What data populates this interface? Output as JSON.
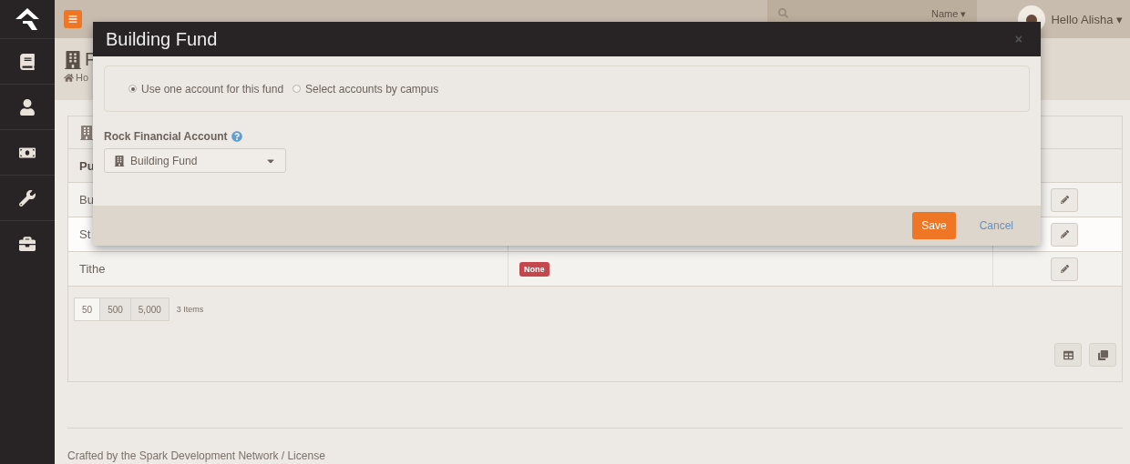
{
  "topbar": {
    "search_filter": "Name",
    "filter_caret": "▾",
    "user_greeting": "Hello Alisha",
    "user_caret": "▾"
  },
  "page": {
    "title": "F",
    "breadcrumb": "Ho"
  },
  "grid": {
    "header": "Pu",
    "rows": [
      {
        "name": "Bu",
        "selected": false
      },
      {
        "name": "St",
        "selected": true
      },
      {
        "name": "Tithe",
        "badge": "None",
        "selected": false
      }
    ],
    "page_sizes": [
      {
        "label": "50",
        "selected": true
      },
      {
        "label": "500",
        "selected": false
      },
      {
        "label": "5,000",
        "selected": false
      }
    ],
    "item_count": "3 Items"
  },
  "footer": "Crafted by the Spark Development Network / License",
  "modal": {
    "title": "Building Fund",
    "close": "×",
    "options": [
      {
        "label": "Use one account for this fund",
        "selected": true
      },
      {
        "label": "Select accounts by campus",
        "selected": false
      }
    ],
    "field_label": "Rock Financial Account",
    "field_value": "Building Fund",
    "buttons": [
      {
        "label": "Save",
        "kind": "primary"
      },
      {
        "label": "Cancel",
        "kind": "link"
      }
    ]
  }
}
